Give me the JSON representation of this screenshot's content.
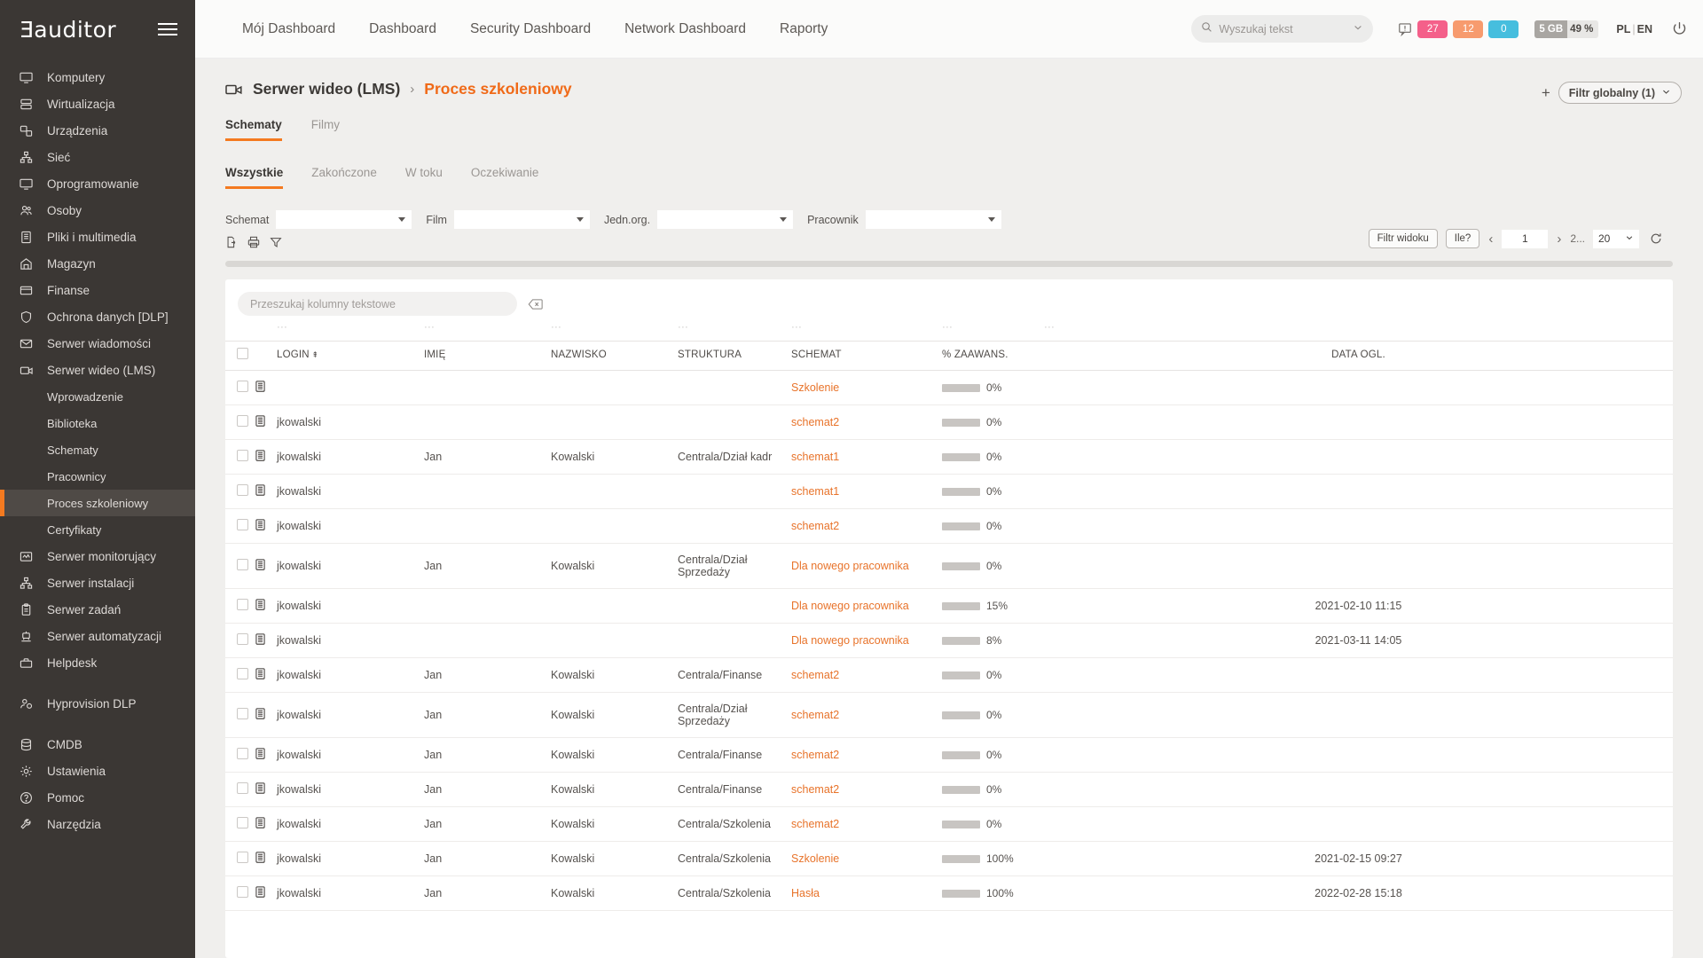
{
  "brand": {
    "logo": "auditor",
    "logo_prefix": "E"
  },
  "sidebar": {
    "items": [
      {
        "label": "Komputery",
        "icon": "monitor-icon"
      },
      {
        "label": "Wirtualizacja",
        "icon": "server-stack-icon"
      },
      {
        "label": "Urządzenia",
        "icon": "devices-icon"
      },
      {
        "label": "Sieć",
        "icon": "network-icon"
      },
      {
        "label": "Oprogramowanie",
        "icon": "monitor-icon"
      },
      {
        "label": "Osoby",
        "icon": "people-icon"
      },
      {
        "label": "Pliki i multimedia",
        "icon": "files-icon"
      },
      {
        "label": "Magazyn",
        "icon": "warehouse-icon"
      },
      {
        "label": "Finanse",
        "icon": "card-icon"
      },
      {
        "label": "Ochrona danych [DLP]",
        "icon": "shield-icon"
      },
      {
        "label": "Serwer wiadomości",
        "icon": "mail-icon"
      },
      {
        "label": "Serwer wideo (LMS)",
        "icon": "video-icon"
      }
    ],
    "sub_items": [
      {
        "label": "Wprowadzenie",
        "active": false
      },
      {
        "label": "Biblioteka",
        "active": false
      },
      {
        "label": "Schematy",
        "active": false
      },
      {
        "label": "Pracownicy",
        "active": false
      },
      {
        "label": "Proces szkoleniowy",
        "active": true
      },
      {
        "label": "Certyfikaty",
        "active": false
      }
    ],
    "items_after": [
      {
        "label": "Serwer monitorujący",
        "icon": "monitoring-icon"
      },
      {
        "label": "Serwer instalacji",
        "icon": "network-icon"
      },
      {
        "label": "Serwer zadań",
        "icon": "clipboard-icon"
      },
      {
        "label": "Serwer automatyzacji",
        "icon": "robot-icon"
      },
      {
        "label": "Helpdesk",
        "icon": "toolbox-icon"
      }
    ],
    "items_group2": [
      {
        "label": "Hyprovision DLP",
        "icon": "user-shield-icon"
      }
    ],
    "items_group3": [
      {
        "label": "CMDB",
        "icon": "database-icon"
      },
      {
        "label": "Ustawienia",
        "icon": "gear-icon"
      },
      {
        "label": "Pomoc",
        "icon": "help-icon"
      },
      {
        "label": "Narzędzia",
        "icon": "tools-icon"
      }
    ]
  },
  "topnav": {
    "links": [
      "Mój Dashboard",
      "Dashboard",
      "Security Dashboard",
      "Network Dashboard",
      "Raporty"
    ],
    "search_placeholder": "Wyszukaj tekst",
    "badges": [
      {
        "value": "27",
        "color": "#f4608a"
      },
      {
        "value": "12",
        "color": "#f79b6e"
      },
      {
        "value": "0",
        "color": "#46bede"
      }
    ],
    "storage": {
      "used": "5 GB",
      "sep": "/",
      "percent": "49 %"
    },
    "lang": {
      "active": "PL",
      "sep": "|",
      "other": "EN"
    }
  },
  "page": {
    "breadcrumb_parent": "Serwer wideo (LMS)",
    "breadcrumb_sep": "›",
    "breadcrumb_current": "Proces szkoleniowy",
    "global_filter": "Filtr globalny (1)",
    "plus": "+"
  },
  "tabs_level1": [
    {
      "label": "Schematy",
      "active": true
    },
    {
      "label": "Filmy",
      "active": false
    }
  ],
  "tabs_level2": [
    {
      "label": "Wszystkie",
      "active": true
    },
    {
      "label": "Zakończone",
      "active": false
    },
    {
      "label": "W toku",
      "active": false
    },
    {
      "label": "Oczekiwanie",
      "active": false
    }
  ],
  "filters": [
    {
      "label": "Schemat",
      "value": ""
    },
    {
      "label": "Film",
      "value": ""
    },
    {
      "label": "Jedn.org.",
      "value": ""
    },
    {
      "label": "Pracownik",
      "value": ""
    }
  ],
  "toolbar_icons": [
    "export-icon",
    "print-icon",
    "filter-icon"
  ],
  "pager": {
    "view_filter": "Filtr widoku",
    "how_many": "Ile?",
    "prev": "‹",
    "page": "1",
    "next": "›",
    "total_pages": "2...",
    "page_size": "20",
    "refresh": "refresh-icon"
  },
  "table": {
    "search_placeholder": "Przeszukaj kolumny tekstowe",
    "columns": [
      "LOGIN",
      "IMIĘ",
      "NAZWISKO",
      "STRUKTURA",
      "SCHEMAT",
      "% ZAAWANS.",
      "DATA OGL."
    ],
    "sort_column": "LOGIN",
    "rows": [
      {
        "login": "",
        "imie": "",
        "nazwisko": "",
        "struktura": "",
        "schemat": "Szkolenie",
        "pct": 0,
        "pct_label": "0%",
        "data": ""
      },
      {
        "login": "jkowalski",
        "imie": "",
        "nazwisko": "",
        "struktura": "",
        "schemat": "schemat2",
        "pct": 0,
        "pct_label": "0%",
        "data": ""
      },
      {
        "login": "jkowalski",
        "imie": "Jan",
        "nazwisko": "Kowalski",
        "struktura": "Centrala/Dział kadr",
        "schemat": "schemat1",
        "pct": 0,
        "pct_label": "0%",
        "data": ""
      },
      {
        "login": "jkowalski",
        "imie": "",
        "nazwisko": "",
        "struktura": "",
        "schemat": "schemat1",
        "pct": 0,
        "pct_label": "0%",
        "data": ""
      },
      {
        "login": "jkowalski",
        "imie": "",
        "nazwisko": "",
        "struktura": "",
        "schemat": "schemat2",
        "pct": 0,
        "pct_label": "0%",
        "data": ""
      },
      {
        "login": "jkowalski",
        "imie": "Jan",
        "nazwisko": "Kowalski",
        "struktura": "Centrala/Dział Sprzedaży",
        "schemat": "Dla nowego pracownika",
        "pct": 0,
        "pct_label": "0%",
        "data": ""
      },
      {
        "login": "jkowalski",
        "imie": "",
        "nazwisko": "",
        "struktura": "",
        "schemat": "Dla nowego pracownika",
        "pct": 15,
        "pct_label": "15%",
        "data": "2021-02-10 11:15"
      },
      {
        "login": "jkowalski",
        "imie": "",
        "nazwisko": "",
        "struktura": "",
        "schemat": "Dla nowego pracownika",
        "pct": 8,
        "pct_label": "8%",
        "data": "2021-03-11 14:05"
      },
      {
        "login": "jkowalski",
        "imie": "Jan",
        "nazwisko": "Kowalski",
        "struktura": "Centrala/Finanse",
        "schemat": "schemat2",
        "pct": 0,
        "pct_label": "0%",
        "data": ""
      },
      {
        "login": "jkowalski",
        "imie": "Jan",
        "nazwisko": "Kowalski",
        "struktura": "Centrala/Dział Sprzedaży",
        "schemat": "schemat2",
        "pct": 0,
        "pct_label": "0%",
        "data": ""
      },
      {
        "login": "jkowalski",
        "imie": "Jan",
        "nazwisko": "Kowalski",
        "struktura": "Centrala/Finanse",
        "schemat": "schemat2",
        "pct": 0,
        "pct_label": "0%",
        "data": ""
      },
      {
        "login": "jkowalski",
        "imie": "Jan",
        "nazwisko": "Kowalski",
        "struktura": "Centrala/Finanse",
        "schemat": "schemat2",
        "pct": 0,
        "pct_label": "0%",
        "data": ""
      },
      {
        "login": "jkowalski",
        "imie": "Jan",
        "nazwisko": "Kowalski",
        "struktura": "Centrala/Szkolenia",
        "schemat": "schemat2",
        "pct": 0,
        "pct_label": "0%",
        "data": ""
      },
      {
        "login": "jkowalski",
        "imie": "Jan",
        "nazwisko": "Kowalski",
        "struktura": "Centrala/Szkolenia",
        "schemat": "Szkolenie",
        "pct": 100,
        "pct_label": "100%",
        "data": "2021-02-15 09:27"
      },
      {
        "login": "jkowalski",
        "imie": "Jan",
        "nazwisko": "Kowalski",
        "struktura": "Centrala/Szkolenia",
        "schemat": "Hasła",
        "pct": 100,
        "pct_label": "100%",
        "data": "2022-02-28 15:18"
      }
    ]
  },
  "colors": {
    "accent": "#f47a20",
    "link": "#e8732a",
    "sidebar_bg": "#3b3734",
    "progress": "#3196d1"
  }
}
